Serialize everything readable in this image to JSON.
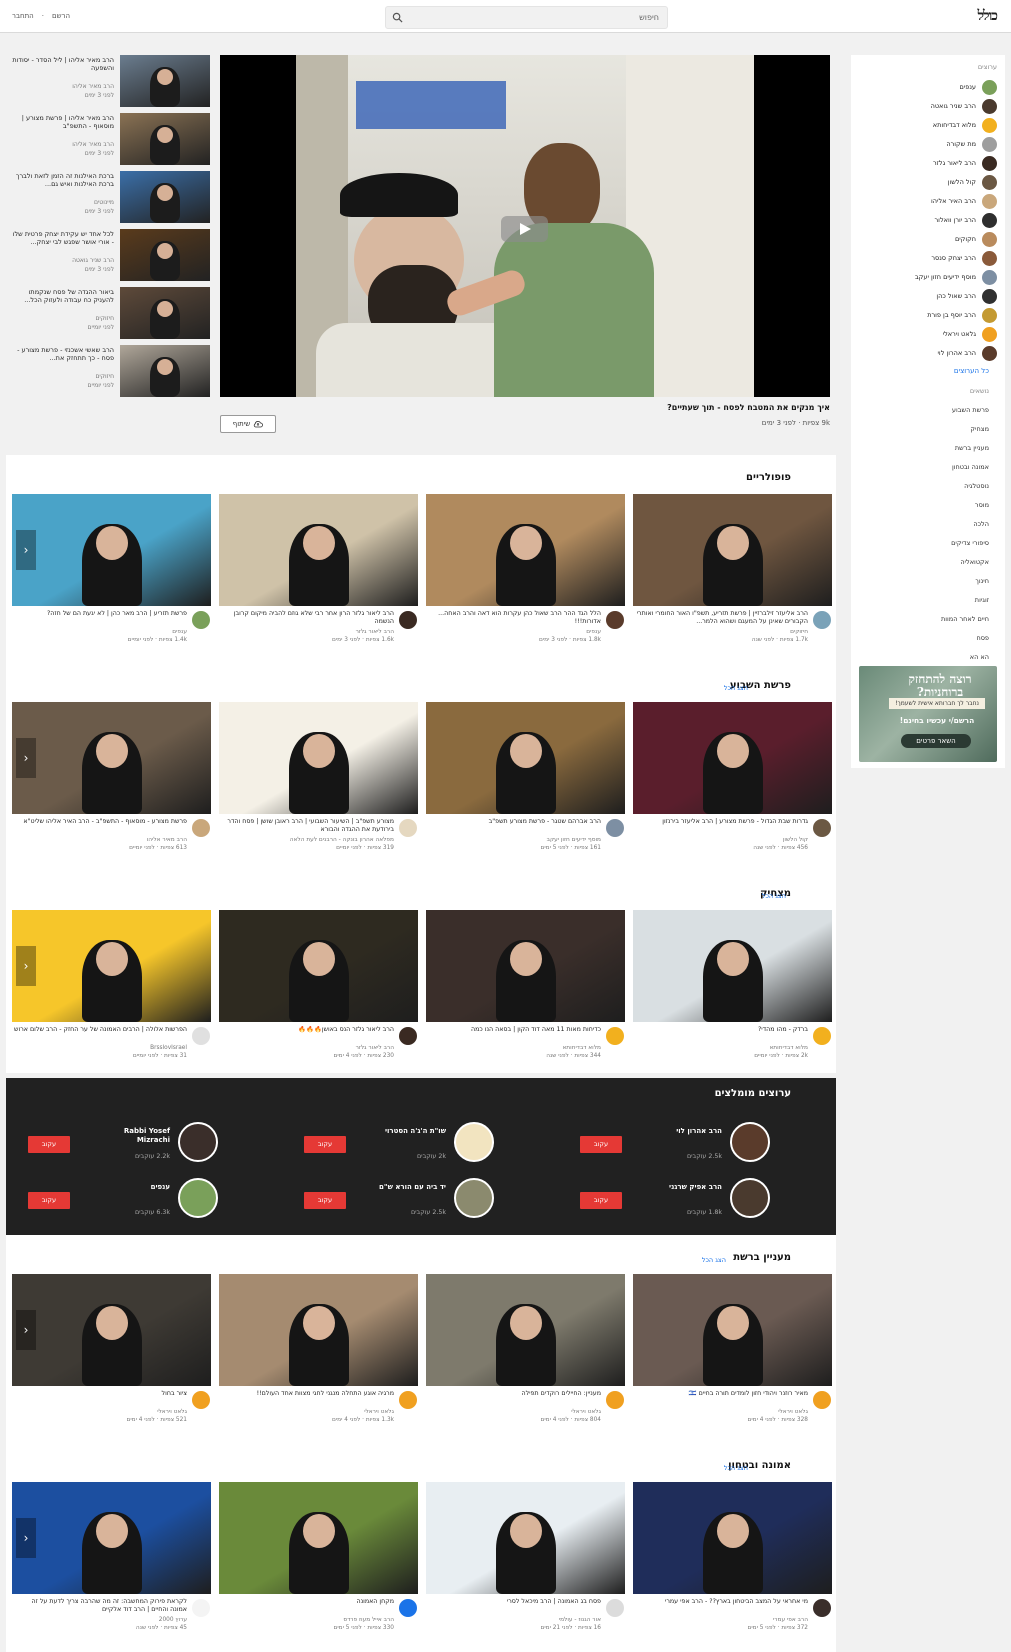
{
  "header": {
    "logo": "כולל",
    "search_placeholder": "חיפוש",
    "links": [
      "הרשם",
      "התחבר"
    ]
  },
  "sidebar": {
    "title": "ערוצים",
    "channels": [
      {
        "name": "ענפים",
        "color": "#7aa05a"
      },
      {
        "name": "הרב שניר גואטה",
        "color": "#4a3a2e"
      },
      {
        "name": "מלוא דבדיחותא",
        "color": "#f2b01e"
      },
      {
        "name": "מת שקורה",
        "color": "#9e9e9e"
      },
      {
        "name": "הרב ליאור גלזר",
        "color": "#3a2a22"
      },
      {
        "name": "קול הלשון",
        "color": "#6b5843"
      },
      {
        "name": "הרב האיר אליהו",
        "color": "#c9a77b"
      },
      {
        "name": "הרב יורן וואלור",
        "color": "#2f2f2f"
      },
      {
        "name": "חקוקים",
        "color": "#b98b5d"
      },
      {
        "name": "הרב יצחק סנסר",
        "color": "#8a5a3a"
      },
      {
        "name": "מוסף ידיעים חזון יעקב",
        "color": "#7d8fa3"
      },
      {
        "name": "הרב שאול כהן",
        "color": "#303030"
      },
      {
        "name": "הרב יוסף בן פורת",
        "color": "#c49a32"
      },
      {
        "name": "גלאט ויראלי",
        "color": "#f0a020"
      },
      {
        "name": "הרב אהרון לוי",
        "color": "#5a3b2b"
      }
    ],
    "all_channels": "כל הערוצים",
    "categories": [
      "נושאים",
      "פרשת השבוע",
      "מצחיק",
      "מעניין ברשת",
      "אמונה ובטחון",
      "נוסטלגיה",
      "מוסר",
      "הלכה",
      "סיפורי צדיקים",
      "אקטואליה",
      "חינוך",
      "זוגיות",
      "חיים לאחר המוות",
      "פסח",
      "הא הא"
    ],
    "ad": {
      "line1": "רוצה להתחזק ברוחניות?",
      "line2": "נחבר לך חברותא אישית לשעמך!",
      "line3": "הרשם/י עכשיו בחינם!",
      "button": "השאר פרטים"
    }
  },
  "player": {
    "title": "איך מנקים את המטבח לפסח - תוך שעתיים?",
    "meta": "9k צפיות · לפני 3 ימים",
    "share": "שיתוף"
  },
  "related": [
    {
      "title": "הרב מאיר אליהו | ליל הסדר - יסודות והשפעה",
      "channel": "הרב מאיר אליהו",
      "meta": "לפני 3 ימים",
      "color": "#6b7d8f"
    },
    {
      "title": "הרב מאיר אליהו | פרשת מצורע | מוסאוף - התשפ\"ב",
      "channel": "הרב מאיר אליהו",
      "meta": "לפני 3 ימים",
      "color": "#8a7254"
    },
    {
      "title": "ברכת האילנות זה הזמן לזאת ולברך ברכת האילנות ואיש גם...",
      "channel": "מיינוטים",
      "meta": "לפני 3 ימים",
      "color": "#3b6fa8"
    },
    {
      "title": "לכל אחד יש עקידת יצחק פרטית שלו - אורי אושר שפגש לבי יצחק...",
      "channel": "הרב שניר גואטה",
      "meta": "לפני 3 ימים",
      "color": "#5a3b1c"
    },
    {
      "title": "ביאור ההגדה של פסח שנקמתו להעניק כח עבודה ולעזוק הכל...",
      "channel": "חיזוקים",
      "meta": "לפני יומיים",
      "color": "#5e4a3a"
    },
    {
      "title": "הרב שאשי אשכנזי - פרשת מצורע - פסח - כך תתחזק את...",
      "channel": "חיזוקים",
      "meta": "לפני יומיים",
      "color": "#b0a79a"
    }
  ],
  "sections": [
    {
      "title": "פופולריים",
      "more": "",
      "videos": [
        {
          "title": "הרב אליעזר זילברזיין | פרשת תזריע, תשפ\"ו האור החומרי ואותרי הקבורים שאינן על המעגם ושהוא הלמר...",
          "channel": "חיזוקים",
          "meta": "1.7k צפיות · לפני שנה",
          "color": "#6f5640",
          "av": "#7aa2b8"
        },
        {
          "title": "הלל הגד ההר הרב שאול כהן עקרות הוא דאה והרב האחה... אדורות!!!",
          "channel": "ענפים",
          "meta": "1.8k צפיות · לפני 3 ימים",
          "color": "#b08a5e",
          "av": "#5a3b2b"
        },
        {
          "title": "הרב ליאור גלזר הרון אחר רבי שלא גוזם להביה מיקום קרובן הנשמה",
          "channel": "הרב ליאור גלזר",
          "meta": "1.6k צפיות · לפני 3 ימים",
          "color": "#cfc2a8",
          "av": "#3a2a22"
        },
        {
          "title": "פרשת תזריע | הרב מאר כהן | לא יגעת הם של חזה?",
          "channel": "ענפים",
          "meta": "1.4k צפיות · לפני יומיים",
          "color": "#4aa3c8",
          "av": "#7aa05a"
        }
      ]
    },
    {
      "title": "פרשת השבוע",
      "more": "הצג הכל",
      "videos": [
        {
          "title": "גדרות שבת הגדול - פרשת מצורע | הרב אליעזר בירנזון",
          "channel": "קול הלשון",
          "meta": "456 צפיות · לפני שנה",
          "color": "#5a1e2c",
          "av": "#6b5843"
        },
        {
          "title": "הרב אברהם שטגר - פרשת מצורע תשפ\"ב",
          "channel": "מוסף ידיעים חזון יעקב",
          "meta": "161 צפיות · לפני 5 ימים",
          "color": "#8a6a3e",
          "av": "#7d8fa3"
        },
        {
          "title": "מצורע תשפ\"ב | השיעור השבועי | הרב ראובן שושן | פסח והדר בירודעת את ההגדה והבורא",
          "channel": "מפלאה אהרון בונקה - הרבנים לעת הלאה",
          "meta": "319 צפיות · לפני יומיים",
          "color": "#f4f0e6",
          "av": "#e5d8c0"
        },
        {
          "title": "פרשת מצורע - מוסאוף - התשפ\"ב - הרב האיר אליהו שליט\"א",
          "channel": "הרב מאיר אליהו",
          "meta": "613 צפיות · לפני יומיים",
          "color": "#6b5b4a",
          "av": "#c9a77b"
        }
      ]
    },
    {
      "title": "מצחיק",
      "more": "הצג הכל",
      "videos": [
        {
          "title": "ברדק - מהו מהדי?",
          "channel": "מלוא דבדיחותא",
          "meta": "2k צפיות · לפני יומיים",
          "color": "#d9dfe2",
          "av": "#f2b01e"
        },
        {
          "title": "כדיחות מאות 11 מאה דוד הקון | בסאה הנו כמה",
          "channel": "מלוא דבדיחותא",
          "meta": "344 צפיות · לפני שנה",
          "color": "#3a2e2a",
          "av": "#f2b01e"
        },
        {
          "title": "הרב ליאור גלזר הנס באושן🔥🔥🔥",
          "channel": "הרב ליאור גלזר",
          "meta": "230 צפיות · לפני 4 ימים",
          "color": "#2e2a20",
          "av": "#3a2a22"
        },
        {
          "title": "הפרשות אלולה | הרבים האמונה של ער החזק - הרב שלום ארוש",
          "channel": "BrsslovIsrael",
          "meta": "31 צפיות · לפני יומיים",
          "color": "#f6c62a",
          "av": "#e0e0e0"
        }
      ]
    }
  ],
  "recommended": {
    "title": "ערוצים מומלצים",
    "button": "עקוב",
    "channels": [
      {
        "name": "הרב אהרון לוי",
        "subs": "2.5k עוקבים",
        "color": "#5a3b2b"
      },
      {
        "name": "שו\"ת ה'ג'ה הסטרוי",
        "subs": "2k עוקבים",
        "color": "#f2e4c0"
      },
      {
        "name": "Rabbi Yosef Mizrachi",
        "subs": "2.2k עוקבים",
        "color": "#3a2e2a"
      },
      {
        "name": "הרב אפיק שרגני",
        "subs": "1.8k עוקבים",
        "color": "#4a3a2e"
      },
      {
        "name": "יד ביה עם הורא ש\"ם",
        "subs": "2.5k עוקבים",
        "color": "#8b8a6e"
      },
      {
        "name": "ענפים",
        "subs": "6.3k עוקבים",
        "color": "#7aa05a"
      }
    ]
  },
  "sections2": [
    {
      "title": "מעניין ברשת",
      "more": "הצג הכל",
      "videos": [
        {
          "title": "מאיר רוזנר ויהודי חזון לומדים תורה בחיים 🇮🇱",
          "channel": "גלאט ויראלי",
          "meta": "328 צפיות · לפני 4 ימים",
          "color": "#6a5a52",
          "av": "#f0a020"
        },
        {
          "title": "מעניין: החיילים רוקדים תפילה",
          "channel": "גלאט ויראלי",
          "meta": "804 צפיות · לפני 4 ימים",
          "color": "#7e7a6c",
          "av": "#f0a020"
        },
        {
          "title": "מרגיה אוגע התחלה מנגני לחגי מצוות אחד העולם!!",
          "channel": "גלאט ויראלי",
          "meta": "1.3k צפיות · לפני 4 ימים",
          "color": "#a58b70",
          "av": "#f0a020"
        },
        {
          "title": "ציור בחול",
          "channel": "גלאט ויראלי",
          "meta": "521 צפיות · לפני 4 ימים",
          "color": "#3e3a34",
          "av": "#f0a020"
        }
      ]
    },
    {
      "title": "אמונה ובטחון",
      "more": "הצג הכל",
      "videos": [
        {
          "title": "מי אחראי על המצב הביטחון בארץ?? - הרב אפי עמרי",
          "channel": "הרב אפי עמרי",
          "meta": "372 צפיות · לפני 5 ימים",
          "color": "#1f2d5a",
          "av": "#3a2e2a"
        },
        {
          "title": "פסח בג האמונה | הרב מיכאל לסרי",
          "channel": "אור הגנוז - עולמי",
          "meta": "16 צפיות · לפני 21 ימים",
          "color": "#e8eef2",
          "av": "#dcdcdc"
        },
        {
          "title": "מקחן האמונה",
          "channel": "הרב אייל מעוז פרדס",
          "meta": "330 צפיות · לפני 5 ימים",
          "color": "#6a8a3a",
          "av": "#1a73e8"
        },
        {
          "title": "לקראת פירוק המחשבה: זה מה שהרבה צריך לדעת על זה אמונה והחיים | הרב דוד אלקיים",
          "channel": "ערוץ 2000",
          "meta": "45 צפיות · לפני שנה",
          "color": "#1c4fa0",
          "av": "#f4f4f4"
        }
      ]
    }
  ]
}
